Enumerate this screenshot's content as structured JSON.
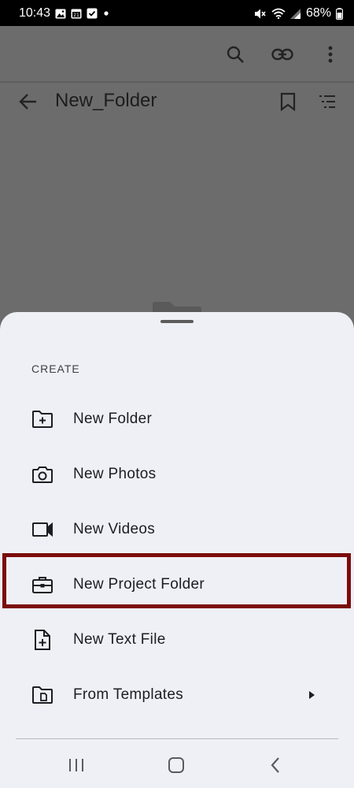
{
  "status_bar": {
    "time": "10:43",
    "battery": "68%",
    "left_icons": [
      "image-icon",
      "calendar-icon",
      "checkbox-icon",
      "dot-icon"
    ],
    "right_icons": [
      "mute-icon",
      "wifi-icon",
      "signal-icon",
      "battery-icon"
    ]
  },
  "topbar": {
    "actions": [
      "search-icon",
      "link-icon",
      "more-vert-icon"
    ]
  },
  "folder_header": {
    "title": "New_Folder",
    "back_icon": "arrow-back-icon",
    "actions": [
      "bookmark-icon",
      "sort-list-icon"
    ]
  },
  "sheet": {
    "section_label": "CREATE",
    "items": [
      {
        "label": "New Folder",
        "icon": "folder-add-icon"
      },
      {
        "label": "New Photos",
        "icon": "camera-icon"
      },
      {
        "label": "New Videos",
        "icon": "video-camera-icon"
      },
      {
        "label": "New Project Folder",
        "icon": "briefcase-icon"
      },
      {
        "label": "New Text File",
        "icon": "file-add-icon"
      },
      {
        "label": "From Templates",
        "icon": "template-folder-icon"
      }
    ],
    "highlighted_index": 3,
    "highlight_color": "#7b0b0b"
  },
  "nav_bar": {
    "buttons": [
      "recents-icon",
      "home-icon",
      "back-icon"
    ]
  }
}
